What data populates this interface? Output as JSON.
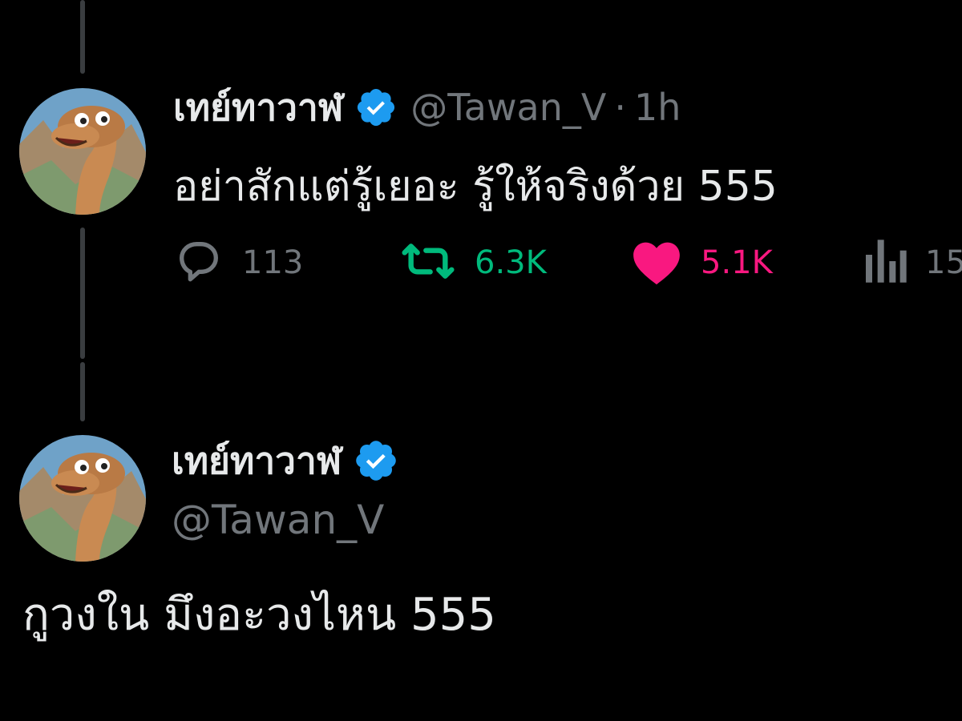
{
  "colors": {
    "background": "#000000",
    "text_primary": "#e7e9ea",
    "text_secondary": "#71767b",
    "verified_blue": "#1d9bf0",
    "retweet_green": "#00ba7c",
    "like_pink": "#f91880",
    "thread_line": "#3a3d40"
  },
  "parent_tweet": {
    "display_name": "เทย์ทาวาฬ",
    "handle": "@Tawan_V",
    "separator": "·",
    "time": "1h",
    "text": "อย่าสักแต่รู้เยอะ รู้ให้จริงด้วย 555",
    "avatar": "dinosaur-avatar",
    "verified_icon": "verified-badge-icon",
    "actions": {
      "reply": {
        "icon": "reply-icon",
        "count": "113"
      },
      "retweet": {
        "icon": "retweet-icon",
        "count": "6.3K",
        "active": true
      },
      "like": {
        "icon": "heart-icon",
        "count": "5.1K",
        "active": true
      },
      "views": {
        "icon": "views-icon",
        "count": "15"
      }
    }
  },
  "reply_tweet": {
    "display_name": "เทย์ทาวาฬ",
    "handle": "@Tawan_V",
    "text": "กูวงใน มึงอะวงไหน 555",
    "avatar": "dinosaur-avatar",
    "verified_icon": "verified-badge-icon"
  }
}
